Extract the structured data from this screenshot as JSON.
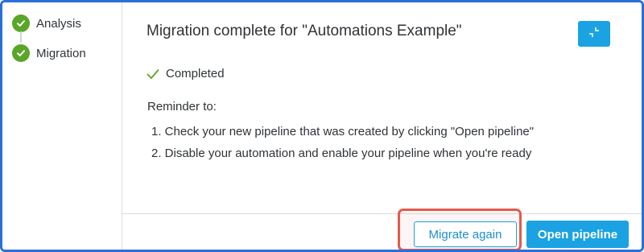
{
  "stepper": {
    "steps": [
      {
        "label": "Analysis",
        "status": "complete"
      },
      {
        "label": "Migration",
        "status": "complete"
      }
    ]
  },
  "main": {
    "title": "Migration complete for \"Automations Example\"",
    "collapse_icon": "collapse-icon",
    "status_icon": "checkmark-icon",
    "status_text": "Completed",
    "reminder_heading": "Reminder to:",
    "reminders": [
      "1. Check your new pipeline that was created by clicking \"Open pipeline\"",
      "2. Disable your automation and enable your pipeline when you're ready"
    ]
  },
  "footer": {
    "migrate_again_label": "Migrate again",
    "open_pipeline_label": "Open pipeline"
  },
  "colors": {
    "accent": "#1ba2e2",
    "success": "#5aa628",
    "highlight": "#e35a4e",
    "frame": "#2a6fd9"
  }
}
